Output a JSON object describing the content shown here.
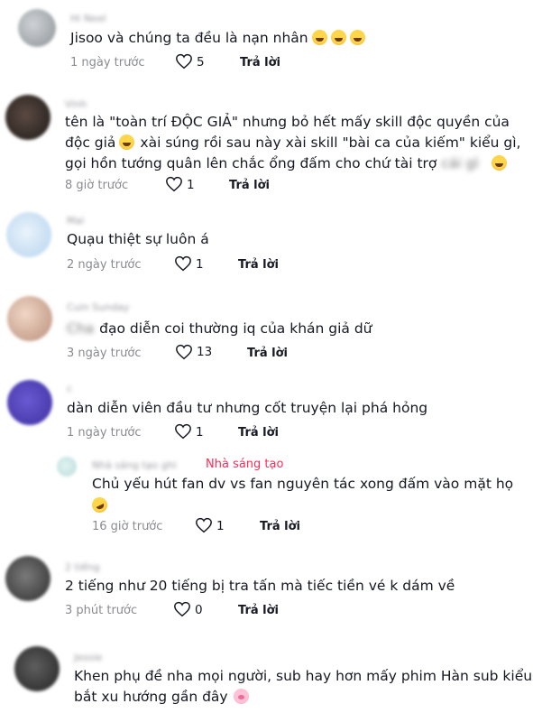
{
  "comments": [
    {
      "username": "Hi Neel",
      "text": "Jisoo và chúng ta đều là nạn nhân",
      "time": "1 ngày trước",
      "likes": "5",
      "reply": "Trả lời"
    },
    {
      "username": "Vinh",
      "line1": "tên là \"toàn trí ĐỘC GIẢ\" nhưng bỏ hết mấy skill độc quyền của",
      "line2": "độc giả",
      "line2b": "xài súng rồi sau này xài skill \"bài ca của kiếm\" kiểu gì,",
      "line3": "gọi hồn tướng quân lên chắc ổng đấm cho chứ tài trợ",
      "line3blur": "cái gì",
      "time": "8 giờ trước",
      "likes": "1",
      "reply": "Trả lời"
    },
    {
      "username": "Mai",
      "text": "Quạu thiệt sự luôn á",
      "time": "2 ngày trước",
      "likes": "1",
      "reply": "Trả lời"
    },
    {
      "username": "Cuin Sunday",
      "prefix": "Cha",
      "text": "đạo diễn coi thường iq của khán giả dữ",
      "time": "3 ngày trước",
      "likes": "13",
      "reply": "Trả lời"
    },
    {
      "username": "c",
      "text": "dàn diễn viên đầu tư nhưng cốt truyện lại phá hỏng",
      "time": "1 ngày trước",
      "likes": "1",
      "reply": "Trả lời"
    },
    {
      "username": "2 tiếng",
      "text": "2 tiếng như 20 tiếng bị tra tấn mà tiếc tiền vé k dám về",
      "time": "3 phút trước",
      "likes": "0",
      "reply": "Trả lời"
    },
    {
      "username": "Jessie",
      "line1": "Khen phụ đề nha mọi người, sub hay hơn mấy phim Hàn sub kiểu",
      "line2": "bắt xu hướng gần đây"
    }
  ],
  "reply": {
    "username": "Nhà sáng tạo ghi",
    "creator_label": "Nhà sáng tạo",
    "line1": "Chủ yếu hút fan dv vs fan nguyên tác xong đấm vào mặt họ",
    "time": "16 giờ trước",
    "likes": "1",
    "reply": "Trả lời"
  },
  "colors": {
    "accent": "#fe2c55",
    "text": "#161823",
    "meta": "#8a8b91"
  }
}
